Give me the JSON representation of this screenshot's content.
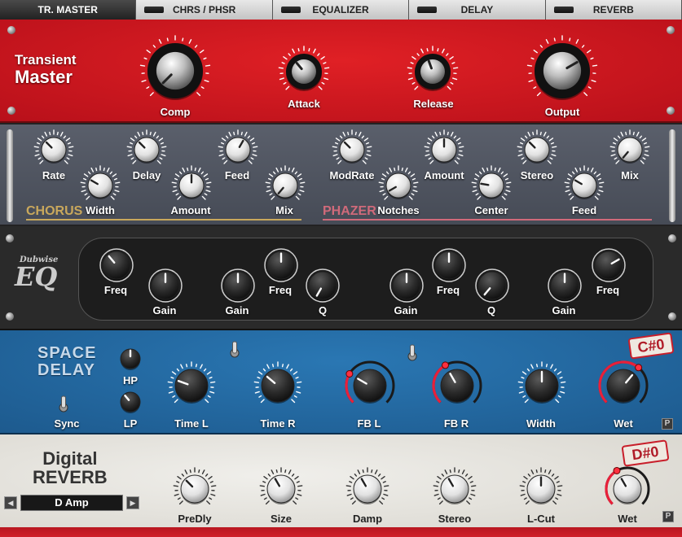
{
  "tabs": [
    {
      "label": "TR. MASTER",
      "active": true
    },
    {
      "label": "CHRS / PHSR",
      "active": false
    },
    {
      "label": "EQUALIZER",
      "active": false
    },
    {
      "label": "DELAY",
      "active": false
    },
    {
      "label": "REVERB",
      "active": false
    }
  ],
  "transient": {
    "title_line1": "Transient",
    "title_line2": "Master",
    "knobs": {
      "comp": "Comp",
      "attack": "Attack",
      "release": "Release",
      "output": "Output"
    }
  },
  "chorus_phazer": {
    "chorus_title": "CHORUS",
    "phazer_title": "PHAZER",
    "chorus_knobs": {
      "rate": "Rate",
      "width": "Width",
      "delay": "Delay",
      "amount": "Amount",
      "feed": "Feed",
      "mix": "Mix"
    },
    "phazer_knobs": {
      "modrate": "ModRate",
      "notches": "Notches",
      "amount": "Amount",
      "center": "Center",
      "stereo": "Stereo",
      "feed": "Feed",
      "mix": "Mix"
    }
  },
  "eq": {
    "logo_top": "Dubwise",
    "logo_main": "EQ",
    "knobs": {
      "freq1": "Freq",
      "gain1": "Gain",
      "gain2": "Gain",
      "freq2": "Freq",
      "q2": "Q",
      "gain3": "Gain",
      "freq3": "Freq",
      "q3": "Q",
      "gain4": "Gain",
      "freq4": "Freq"
    }
  },
  "delay": {
    "title_line1": "SPACE",
    "title_line2": "DELAY",
    "knobs": {
      "hp": "HP",
      "lp": "LP",
      "sync": "Sync",
      "time_l": "Time L",
      "time_r": "Time R",
      "fb_l": "FB L",
      "fb_r": "FB R",
      "width": "Width",
      "wet": "Wet"
    },
    "preset_tag": "C#0",
    "p_button": "P"
  },
  "reverb": {
    "title_line1": "Digital",
    "title_line2": "REVERB",
    "preset": "D Amp",
    "knobs": {
      "predly": "PreDly",
      "size": "Size",
      "damp": "Damp",
      "stereo": "Stereo",
      "lcut": "L-Cut",
      "wet": "Wet"
    },
    "preset_tag": "D#0",
    "p_button": "P"
  },
  "colors": {
    "transient_bg": "#d4161b",
    "chorus_bg": "#4f5460",
    "eq_bg": "#262626",
    "delay_bg": "#2469a0",
    "reverb_bg": "#e8e6e0",
    "accent": "#e8203a"
  }
}
